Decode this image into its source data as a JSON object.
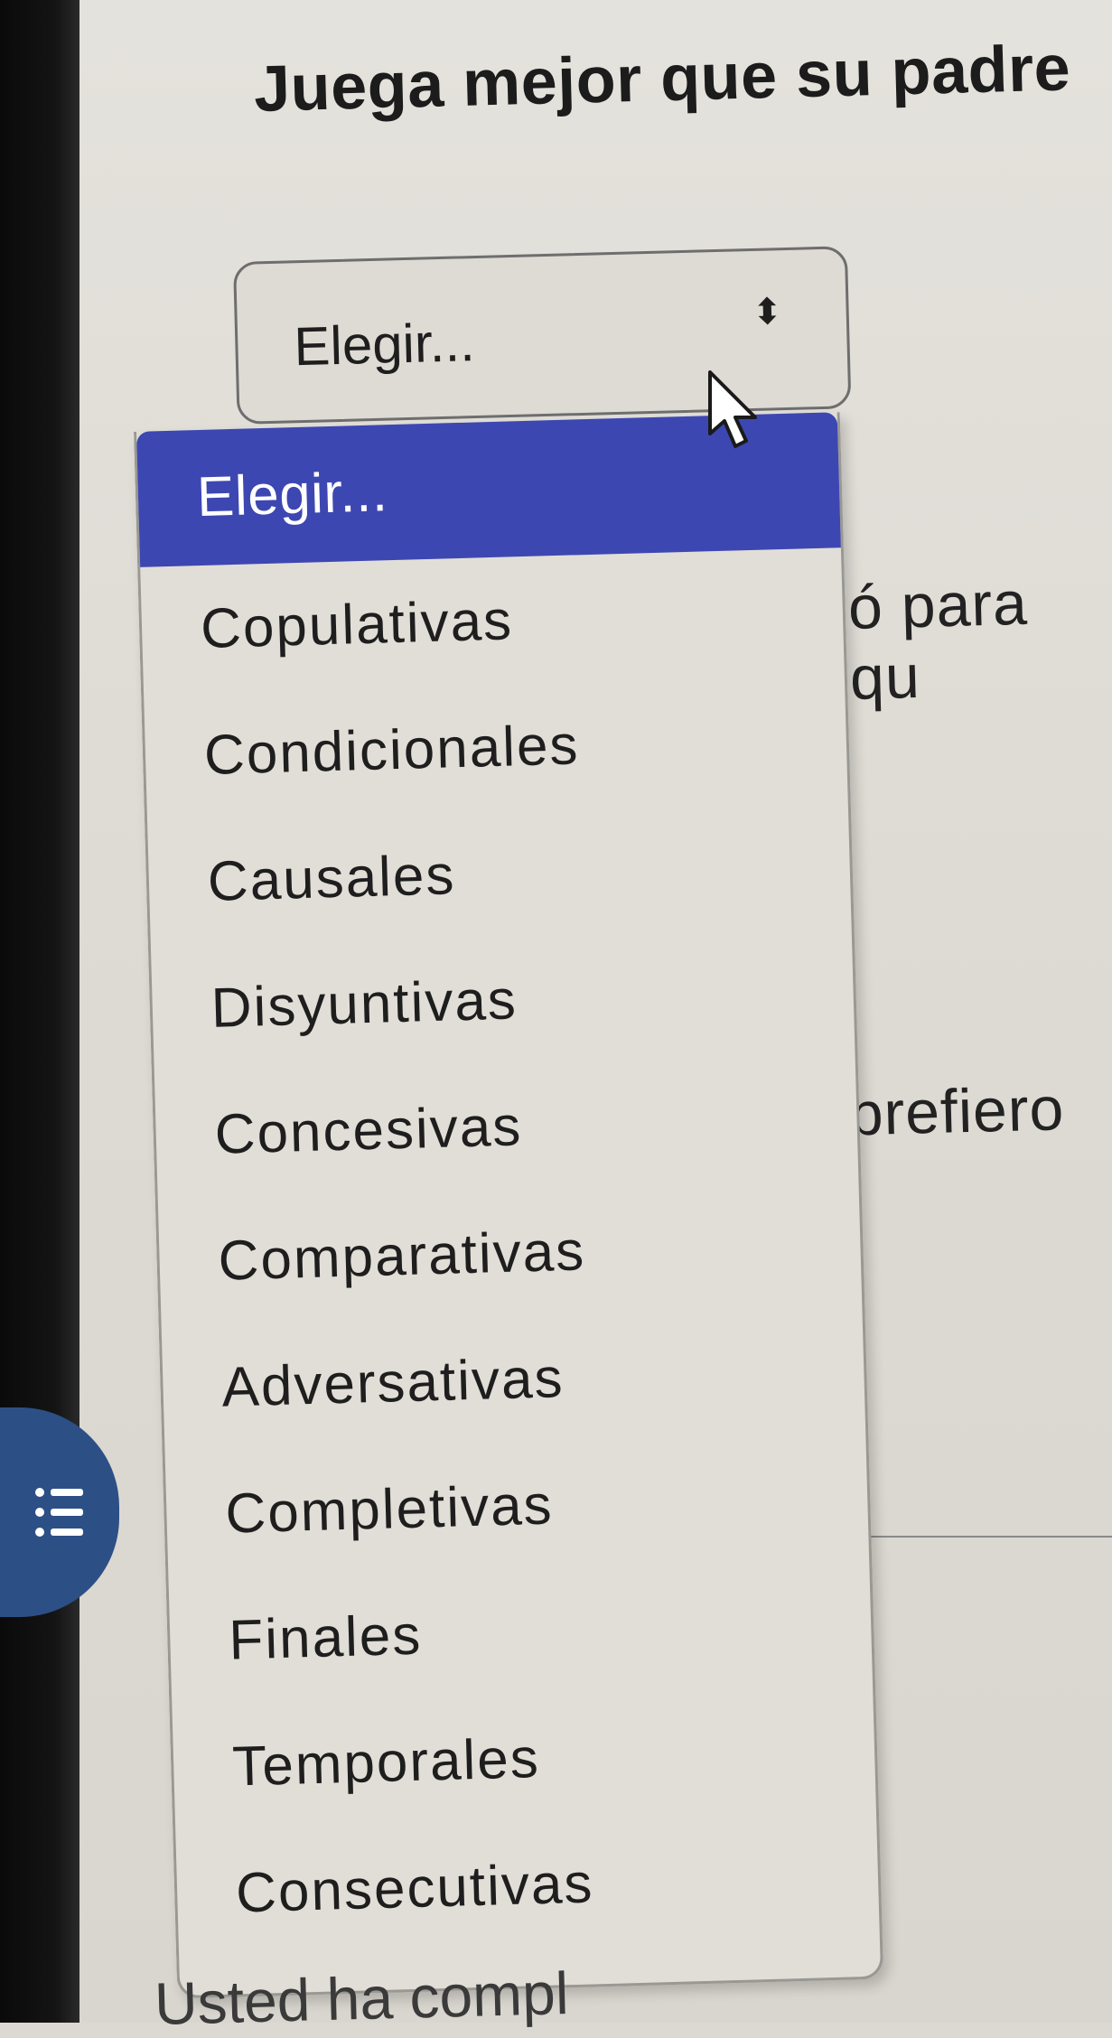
{
  "question": {
    "text": "Juega mejor que su padre"
  },
  "select": {
    "value": "Elegir...",
    "arrows": "⬍",
    "options": [
      {
        "label": "Elegir...",
        "selected": true
      },
      {
        "label": "Copulativas"
      },
      {
        "label": "Condicionales"
      },
      {
        "label": "Causales"
      },
      {
        "label": "Disyuntivas"
      },
      {
        "label": "Concesivas"
      },
      {
        "label": "Comparativas"
      },
      {
        "label": "Adversativas"
      },
      {
        "label": "Completivas"
      },
      {
        "label": "Finales"
      },
      {
        "label": "Temporales"
      },
      {
        "label": "Consecutivas"
      }
    ]
  },
  "background": {
    "partial_text_1": "ó para qu",
    "partial_text_2": "e prefiero",
    "bottom_text": "Usted ha compl"
  },
  "colors": {
    "highlight": "#3d47b2",
    "fab": "#2c4f86"
  },
  "icons": {
    "fab": "list-icon",
    "cursor": "mouse-pointer-icon"
  }
}
